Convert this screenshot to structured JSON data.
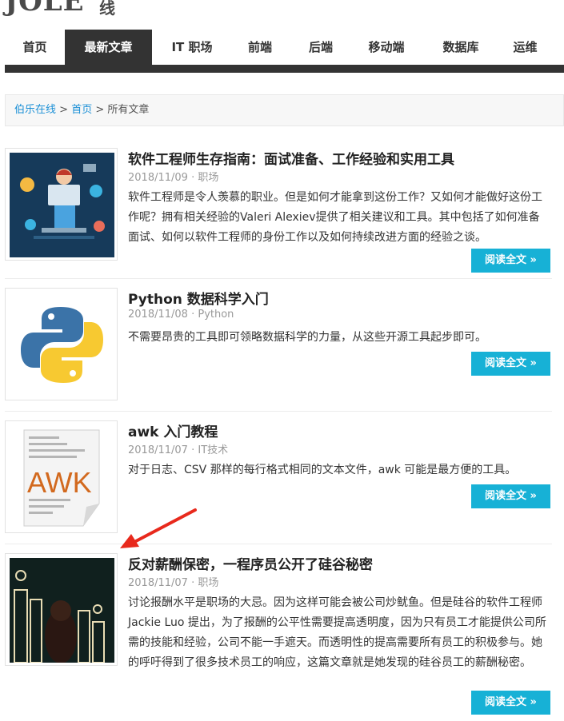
{
  "logo": {
    "text": "JOLE",
    "suffix": "线"
  },
  "nav": {
    "items": [
      {
        "label": "首页",
        "active": false
      },
      {
        "label": "最新文章",
        "active": true
      },
      {
        "label": "IT 职场",
        "active": false
      },
      {
        "label": "前端",
        "active": false
      },
      {
        "label": "后端",
        "active": false
      },
      {
        "label": "移动端",
        "active": false
      },
      {
        "label": "数据库",
        "active": false
      },
      {
        "label": "运维",
        "active": false
      }
    ]
  },
  "breadcrumb": {
    "site": "伯乐在线",
    "sep1": ">",
    "home": "首页",
    "sep2": ">",
    "current": "所有文章"
  },
  "posts": [
    {
      "title": "软件工程师生存指南：面试准备、工作经验和实用工具",
      "date": "2018/11/09",
      "sep": "·",
      "category": "职场",
      "excerpt": "软件工程师是令人羡慕的职业。但是如何才能拿到这份工作？又如何才能做好这份工作呢？拥有相关经验的Valeri Alexiev提供了相关建议和工具。其中包括了如何准备面试、如何以软件工程师的身份工作以及如何持续改进方面的经验之谈。",
      "read_label": "阅读全文 »"
    },
    {
      "title": "Python 数据科学入门",
      "date": "2018/11/08",
      "sep": "·",
      "category": "Python",
      "excerpt": "不需要昂贵的工具即可领略数据科学的力量，从这些开源工具起步即可。",
      "read_label": "阅读全文 »"
    },
    {
      "title": "awk 入门教程",
      "date": "2018/11/07",
      "sep": "·",
      "category": "IT技术",
      "excerpt": "对于日志、CSV 那样的每行格式相同的文本文件，awk 可能是最方便的工具。",
      "read_label": "阅读全文 »",
      "thumb_text": "AWK"
    },
    {
      "title": "反对薪酬保密，一程序员公开了硅谷秘密",
      "date": "2018/11/07",
      "sep": "·",
      "category": "职场",
      "excerpt": "讨论报酬水平是职场的大忌。因为这样可能会被公司炒鱿鱼。但是硅谷的软件工程师 Jackie Luo 提出，为了报酬的公平性需要提高透明度，因为只有员工才能提供公司所需的技能和经验，公司不能一手遮天。而透明性的提高需要所有员工的积极参与。她的呼吁得到了很多技术员工的响应，这篇文章就是她发现的硅谷员工的薪酬秘密。",
      "read_label": "阅读全文 »"
    }
  ],
  "colors": {
    "accent": "#17b1d6",
    "nav_dark": "#333333",
    "link": "#1a8fd6",
    "arrow": "#e8291c"
  }
}
